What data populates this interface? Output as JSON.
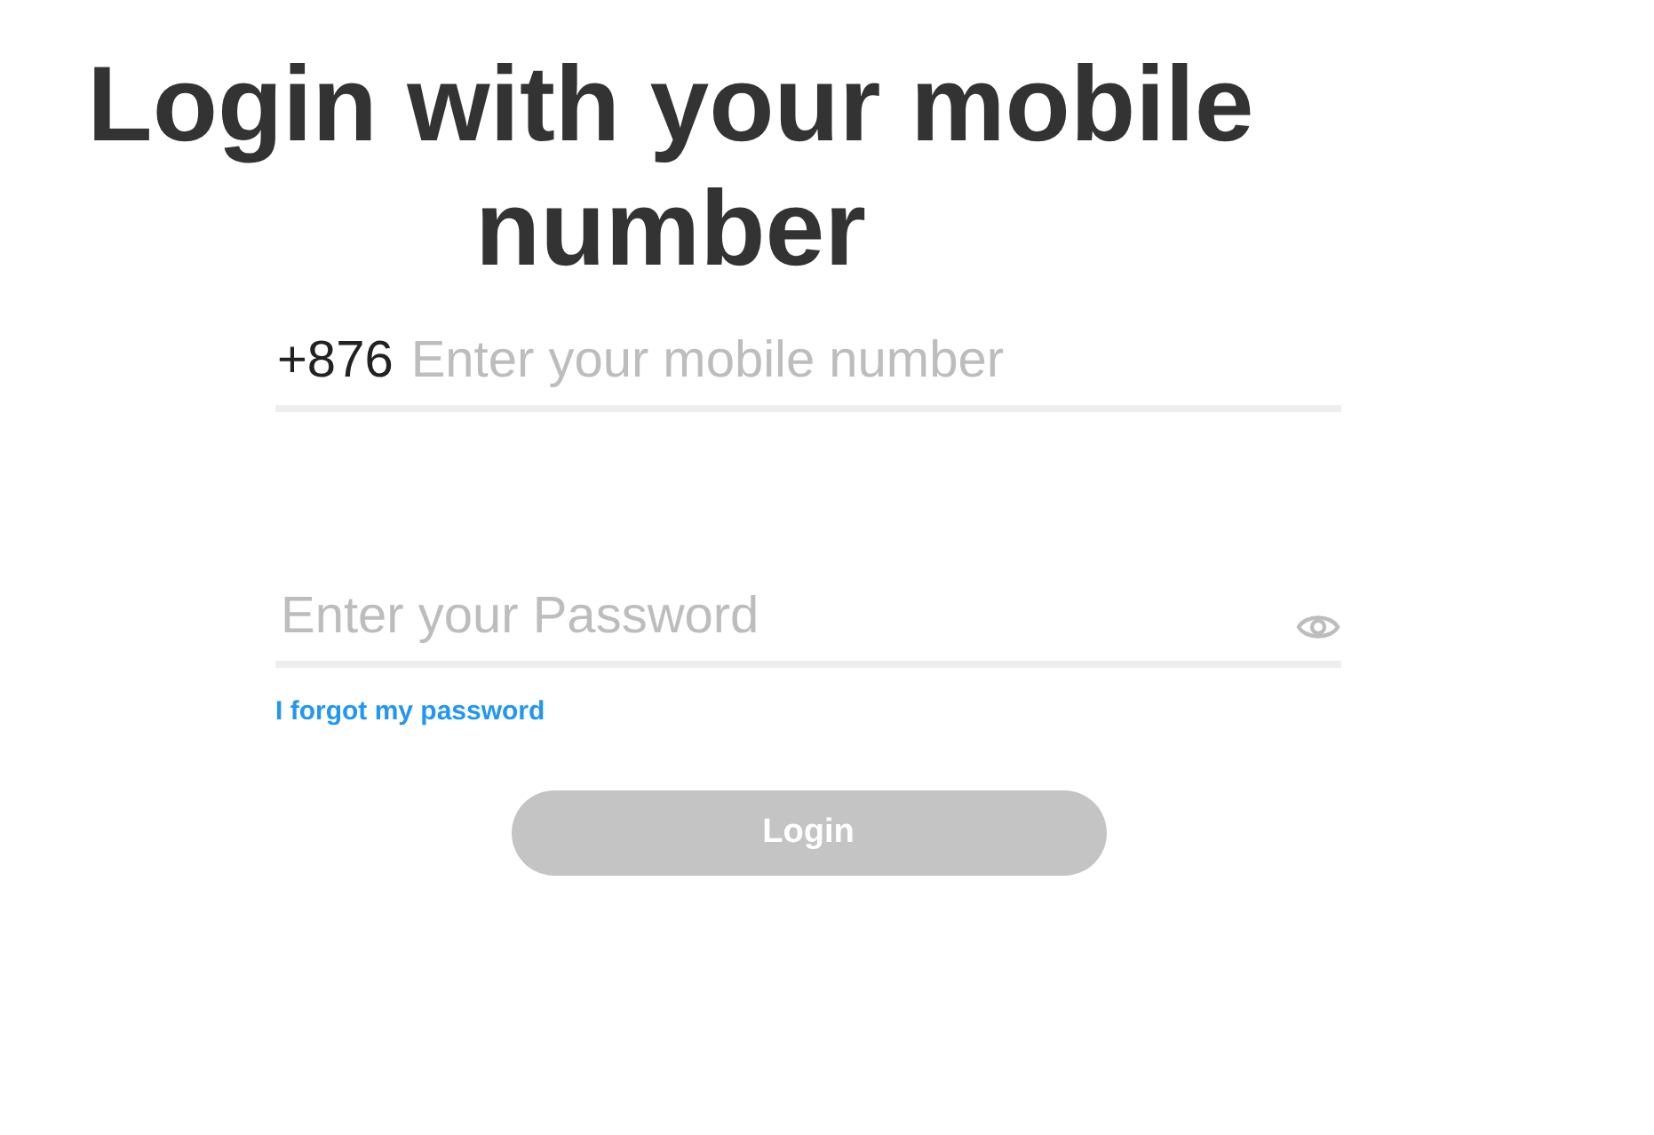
{
  "title": "Login with your mobile number",
  "phone": {
    "prefix": "+876",
    "placeholder": "Enter your mobile number"
  },
  "password": {
    "placeholder": "Enter your Password"
  },
  "forgot_link": "I forgot my password",
  "login_button": {
    "label": "Login",
    "disabled": true
  }
}
